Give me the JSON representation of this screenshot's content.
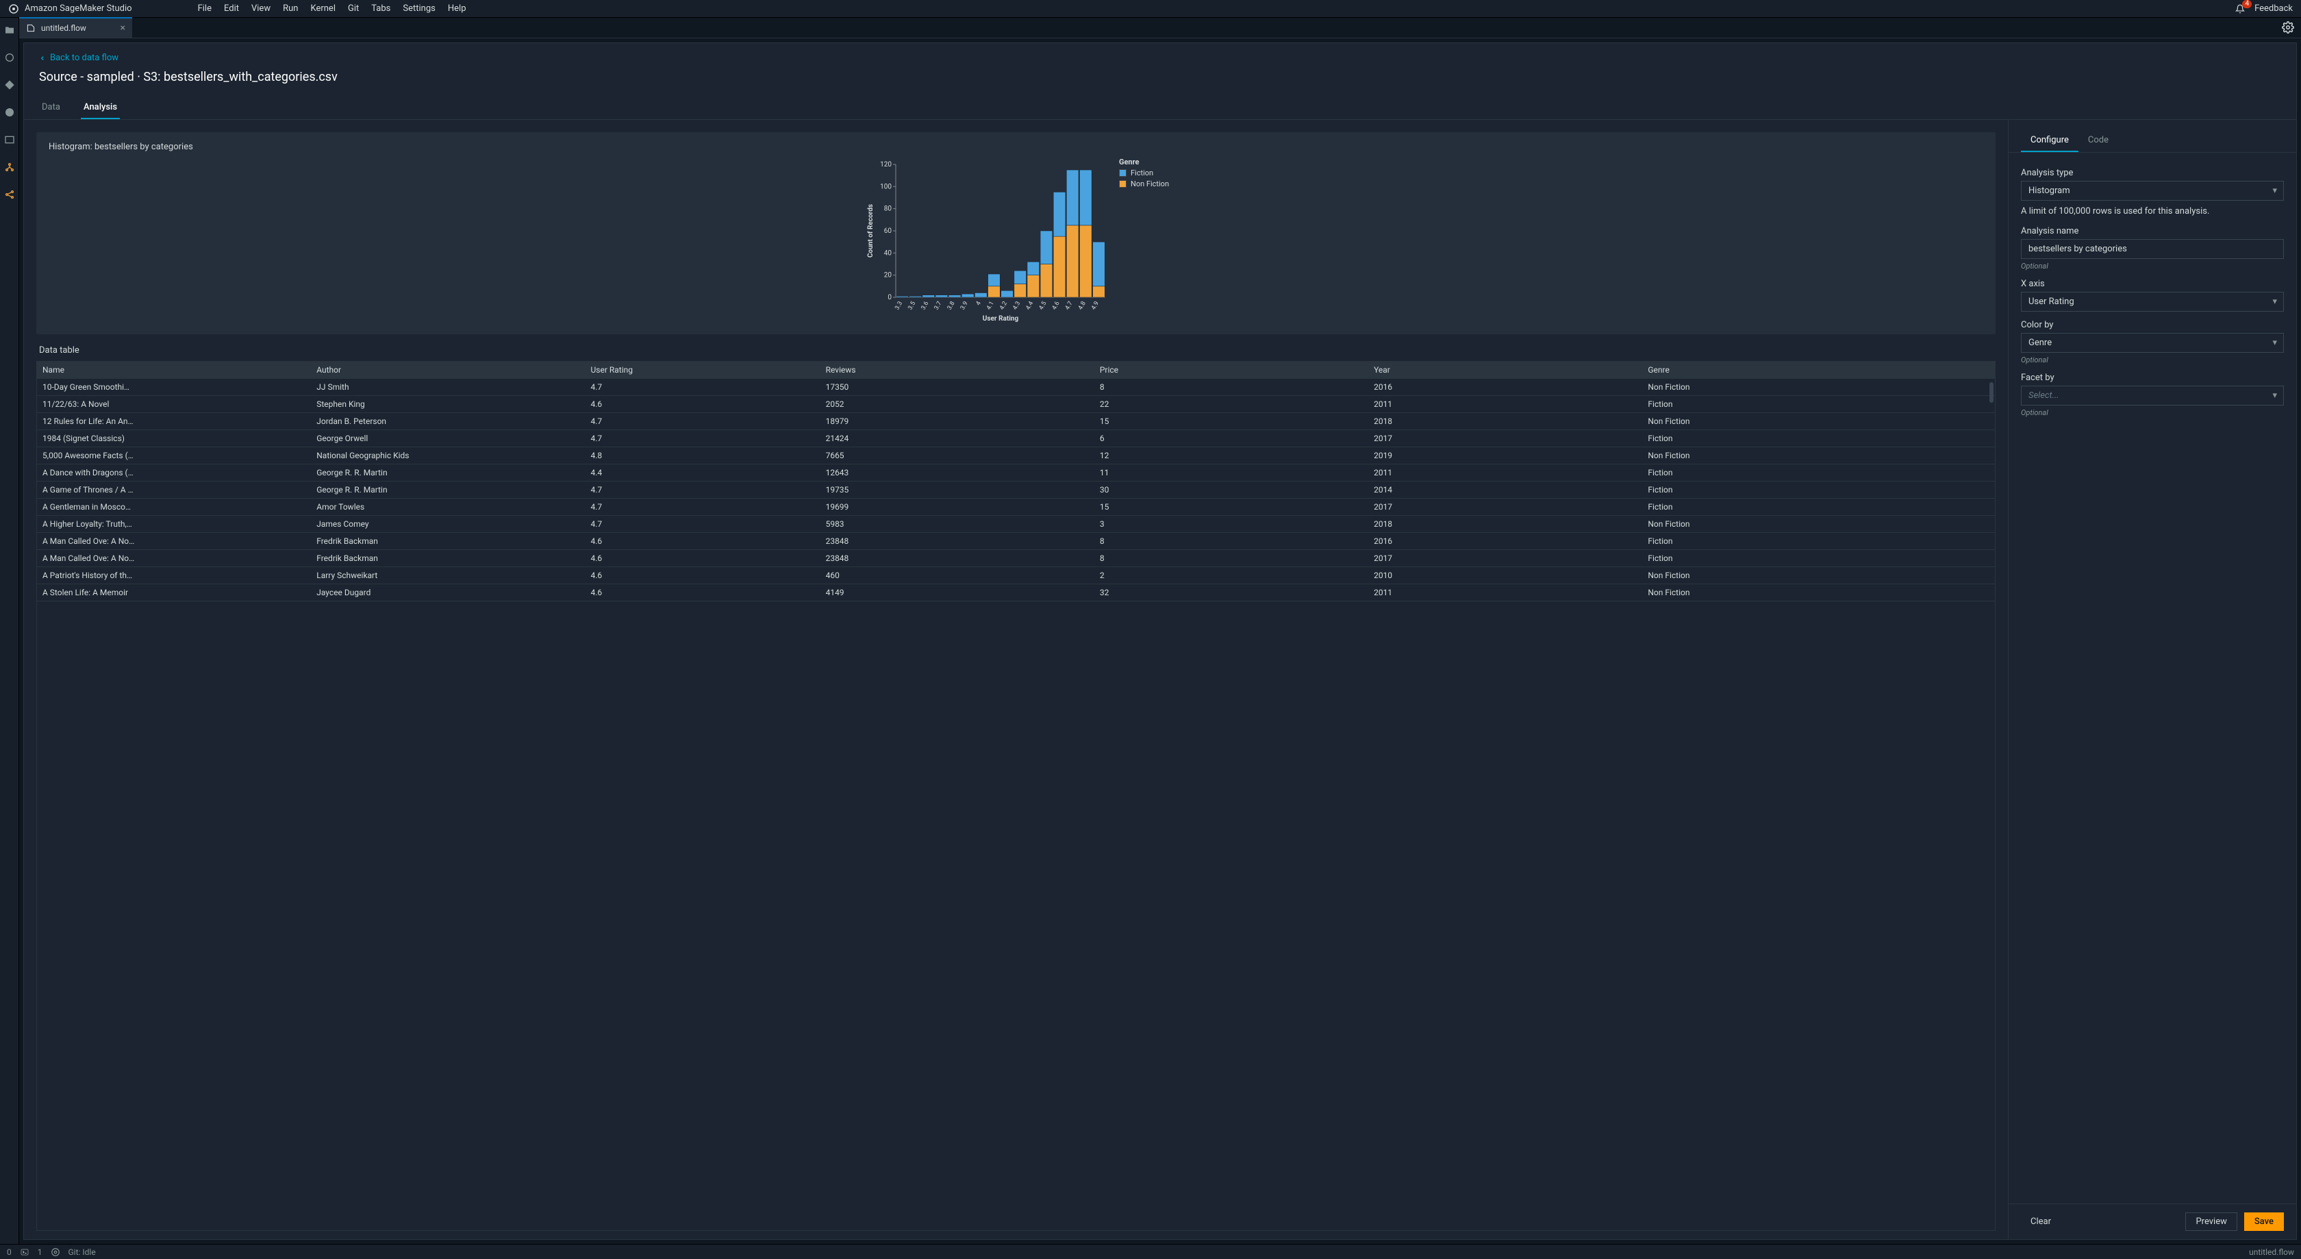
{
  "app": {
    "name": "Amazon SageMaker Studio"
  },
  "menu": [
    "File",
    "Edit",
    "View",
    "Run",
    "Kernel",
    "Git",
    "Tabs",
    "Settings",
    "Help"
  ],
  "notifications": "4",
  "feedback": "Feedback",
  "file_tab": {
    "name": "untitled.flow"
  },
  "back": "Back to data flow",
  "page_title": "Source - sampled · S3: bestsellers_with_categories.csv",
  "tabs": {
    "data": "Data",
    "analysis": "Analysis"
  },
  "chart_title": "Histogram: bestsellers by categories",
  "data_table_label": "Data table",
  "columns": [
    "Name",
    "Author",
    "User Rating",
    "Reviews",
    "Price",
    "Year",
    "Genre"
  ],
  "rows": [
    [
      "10-Day Green Smoothi…",
      "JJ Smith",
      "4.7",
      "17350",
      "8",
      "2016",
      "Non Fiction"
    ],
    [
      "11/22/63: A Novel",
      "Stephen King",
      "4.6",
      "2052",
      "22",
      "2011",
      "Fiction"
    ],
    [
      "12 Rules for Life: An An…",
      "Jordan B. Peterson",
      "4.7",
      "18979",
      "15",
      "2018",
      "Non Fiction"
    ],
    [
      "1984 (Signet Classics)",
      "George Orwell",
      "4.7",
      "21424",
      "6",
      "2017",
      "Fiction"
    ],
    [
      "5,000 Awesome Facts (…",
      "National Geographic Kids",
      "4.8",
      "7665",
      "12",
      "2019",
      "Non Fiction"
    ],
    [
      "A Dance with Dragons (…",
      "George R. R. Martin",
      "4.4",
      "12643",
      "11",
      "2011",
      "Fiction"
    ],
    [
      "A Game of Thrones / A …",
      "George R. R. Martin",
      "4.7",
      "19735",
      "30",
      "2014",
      "Fiction"
    ],
    [
      "A Gentleman in Mosco…",
      "Amor Towles",
      "4.7",
      "19699",
      "15",
      "2017",
      "Fiction"
    ],
    [
      "A Higher Loyalty: Truth,…",
      "James Comey",
      "4.7",
      "5983",
      "3",
      "2018",
      "Non Fiction"
    ],
    [
      "A Man Called Ove: A No…",
      "Fredrik Backman",
      "4.6",
      "23848",
      "8",
      "2016",
      "Fiction"
    ],
    [
      "A Man Called Ove: A No…",
      "Fredrik Backman",
      "4.6",
      "23848",
      "8",
      "2017",
      "Fiction"
    ],
    [
      "A Patriot's History of th…",
      "Larry Schweikart",
      "4.6",
      "460",
      "2",
      "2010",
      "Non Fiction"
    ],
    [
      "A Stolen Life: A Memoir",
      "Jaycee Dugard",
      "4.6",
      "4149",
      "32",
      "2011",
      "Non Fiction"
    ]
  ],
  "right": {
    "configure": "Configure",
    "code": "Code",
    "analysis_type_label": "Analysis type",
    "analysis_type_value": "Histogram",
    "limit_note": "A limit of 100,000 rows is used for this analysis.",
    "analysis_name_label": "Analysis name",
    "analysis_name_value": "bestsellers by categories",
    "optional": "Optional",
    "xaxis_label": "X axis",
    "xaxis_value": "User Rating",
    "colorby_label": "Color by",
    "colorby_value": "Genre",
    "facetby_label": "Facet by",
    "facetby_placeholder": "Select...",
    "clear": "Clear",
    "preview": "Preview",
    "save": "Save"
  },
  "status": {
    "idle": "Git: Idle",
    "one": "1",
    "zero": "0",
    "file": "untitled.flow"
  },
  "chart_data": {
    "type": "bar",
    "stacked": true,
    "title": "Histogram: bestsellers by categories",
    "xlabel": "User Rating",
    "ylabel": "Count of Records",
    "ylim": [
      0,
      120
    ],
    "yticks": [
      0,
      20,
      40,
      60,
      80,
      100,
      120
    ],
    "categories": [
      "3.3",
      "3.5",
      "3.6",
      "3.7",
      "3.8",
      "3.9",
      "4",
      "4.1",
      "4.2",
      "4.3",
      "4.4",
      "4.5",
      "4.6",
      "4.7",
      "4.8",
      "4.9"
    ],
    "legend_title": "Genre",
    "series": [
      {
        "name": "Fiction",
        "color": "#4aa3df",
        "values": [
          1,
          1,
          2,
          2,
          2,
          3,
          4,
          11,
          6,
          12,
          12,
          30,
          40,
          50,
          50,
          40
        ]
      },
      {
        "name": "Non Fiction",
        "color": "#f0a33a",
        "values": [
          0,
          0,
          0,
          0,
          0,
          0,
          0,
          10,
          0,
          12,
          20,
          30,
          55,
          65,
          65,
          10
        ]
      }
    ]
  }
}
